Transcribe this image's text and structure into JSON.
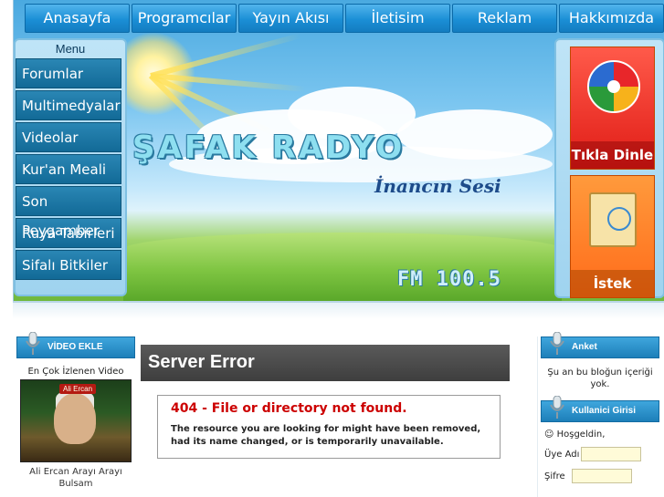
{
  "nav": {
    "items": [
      "Anasayfa",
      "Programcılar",
      "Yayın Akısı",
      "İletisim",
      "Reklam",
      "Hakkımızda"
    ]
  },
  "banner": {
    "title": "ŞAFAK RADYO",
    "tagline": "İnancın Sesi",
    "frequency": "FM 100.5"
  },
  "left_menu": {
    "title": "Menu",
    "items": [
      "Forumlar",
      "Multimedyalar",
      "Videolar",
      "Kur'an Meali",
      "Son Peygamber",
      "Ruya Tabirleri",
      "Sifalı Bitkiler"
    ]
  },
  "right_promos": {
    "listen_label": "Tıkla Dinle",
    "request_label": "İstek Gönder"
  },
  "video_box": {
    "header": "VİDEO EKLE",
    "caption": "En Çok İzlenen Video",
    "thumb_badge": "Ali Ercan",
    "title": "Ali Ercan Arayı Arayı Bulsam"
  },
  "main": {
    "heading": "Server Error",
    "error_title": "404 - File or directory not found.",
    "error_message": "The resource you are looking for might have been removed, had its name changed, or is temporarily unavailable."
  },
  "poll_box": {
    "header": "Anket",
    "text": "Şu an bu bloğun içeriği yok."
  },
  "login_box": {
    "header": "Kullanici Girisi",
    "welcome": "Hoşgeldin,",
    "username_label": "Üye Adı",
    "password_label": "Şifre"
  },
  "colors": {
    "nav_blue": "#1b8fd6",
    "menu_blue": "#126a97",
    "error_red": "#cc0000",
    "promo_red": "#e01c16",
    "promo_orange": "#ff6b1a",
    "main_header_gray": "#3e3e3e"
  }
}
